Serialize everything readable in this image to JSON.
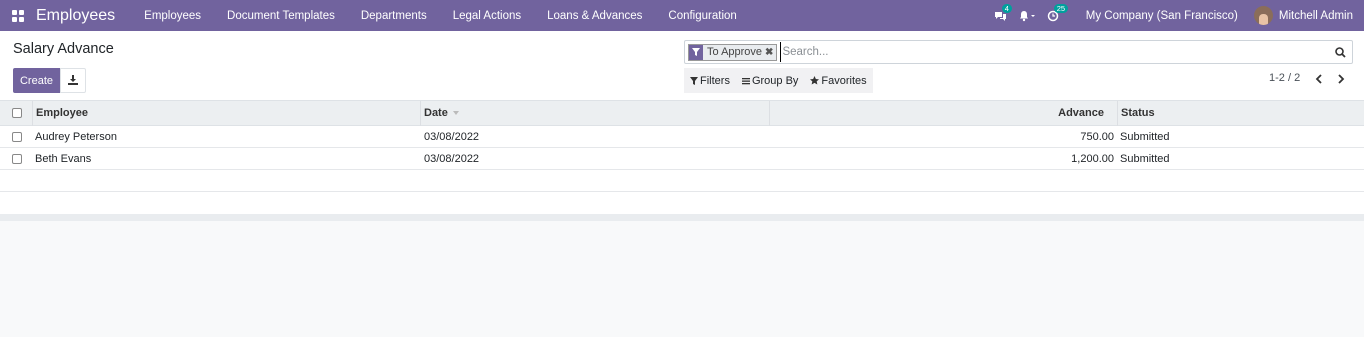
{
  "navbar": {
    "app_title": "Employees",
    "menu": [
      "Employees",
      "Document Templates",
      "Departments",
      "Legal Actions",
      "Loans & Advances",
      "Configuration"
    ],
    "messages_count": "4",
    "activities_count": "25",
    "company": "My Company (San Francisco)",
    "user": "Mitchell Admin",
    "colors": {
      "brand": "#71639e",
      "badge": "#00a09d"
    }
  },
  "control_panel": {
    "title": "Salary Advance",
    "create_label": "Create",
    "search": {
      "facet_label": "To Approve",
      "placeholder": "Search..."
    },
    "filters_label": "Filters",
    "group_by_label": "Group By",
    "favorites_label": "Favorites",
    "pager": "1-2 / 2"
  },
  "table": {
    "columns": {
      "employee": "Employee",
      "date": "Date",
      "advance": "Advance",
      "status": "Status"
    },
    "rows": [
      {
        "employee": "Audrey Peterson",
        "date": "03/08/2022",
        "advance": "750.00",
        "status": "Submitted"
      },
      {
        "employee": "Beth Evans",
        "date": "03/08/2022",
        "advance": "1,200.00",
        "status": "Submitted"
      }
    ]
  }
}
